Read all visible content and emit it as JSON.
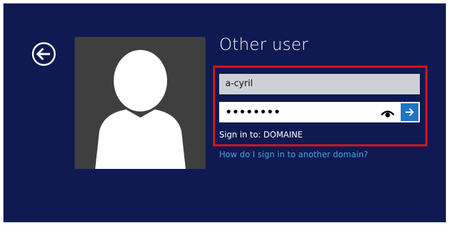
{
  "screen": {
    "title": "Other user",
    "username_value": "a-cyril",
    "password_value": "••••••••",
    "sign_in_to": "Sign in to: DOMAINE",
    "help_link": "How do I sign in to another domain?"
  },
  "icons": {
    "back": "back-arrow-icon",
    "reveal": "eye-icon",
    "submit": "right-arrow-icon",
    "avatar": "user-silhouette-icon"
  },
  "colors": {
    "background": "#0f1a52",
    "avatar_bg": "#3f3f3f",
    "submit_button": "#1e74c6",
    "highlight_border": "#e0101c",
    "link": "#4aa0e8"
  }
}
